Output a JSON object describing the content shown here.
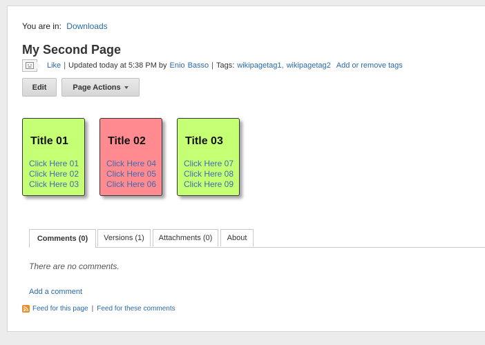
{
  "breadcrumb": {
    "prefix": "You are in:",
    "link": "Downloads"
  },
  "page": {
    "title": "My Second Page"
  },
  "meta": {
    "like": "Like",
    "sep": "|",
    "updated": "Updated today at 5:38 PM by",
    "author_first": "Enio",
    "author_last": "Basso",
    "tags_label": "Tags:",
    "tag1": "wikipagetag1,",
    "tag2": "wikipagetag2",
    "add_tags": "Add or remove tags"
  },
  "toolbar": {
    "edit": "Edit",
    "page_actions": "Page Actions"
  },
  "cards": [
    {
      "title": "Title 01",
      "color": "#c5ff73",
      "links": [
        "Click Here 01",
        "Click Here 02",
        "Click Here 03"
      ]
    },
    {
      "title": "Title 02",
      "color": "#ff8a8f",
      "links": [
        "Click Here 04",
        "Click Here 05",
        "Click Here 06"
      ]
    },
    {
      "title": "Title 03",
      "color": "#c5ff73",
      "links": [
        "Click Here 07",
        "Click Here 08",
        "Click Here 09"
      ]
    }
  ],
  "tabs": [
    {
      "label": "Comments (0)",
      "active": true
    },
    {
      "label": "Versions (1)",
      "active": false
    },
    {
      "label": "Attachments (0)",
      "active": false
    },
    {
      "label": "About",
      "active": false
    }
  ],
  "comments": {
    "empty_text": "There are no comments.",
    "add": "Add a comment"
  },
  "feeds": {
    "page": "Feed for this page",
    "sep": "|",
    "comments": "Feed for these comments"
  },
  "colors": {
    "link": "#2a6aa8",
    "card_green": "#c5ff73",
    "card_red": "#ff8a8f"
  }
}
